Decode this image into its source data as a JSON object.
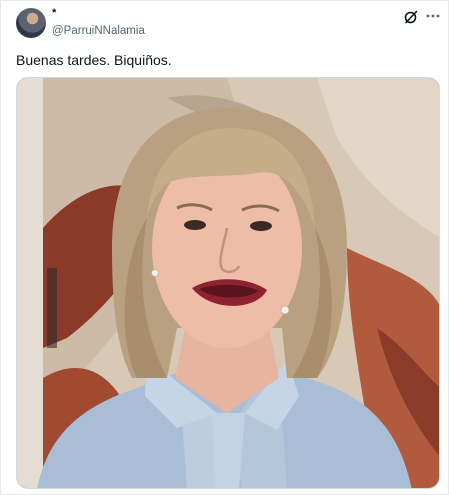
{
  "tweet": {
    "author_name": "*",
    "author_handle": "@ParruiNNalamia",
    "text": "Buenas tardes. Biquiños."
  },
  "icons": {
    "avatar": "avatar",
    "grok": "grok-icon",
    "more": "more-icon"
  },
  "colors": {
    "text": "#0f1419",
    "secondary_text": "#536471",
    "border": "#cfd9de"
  }
}
